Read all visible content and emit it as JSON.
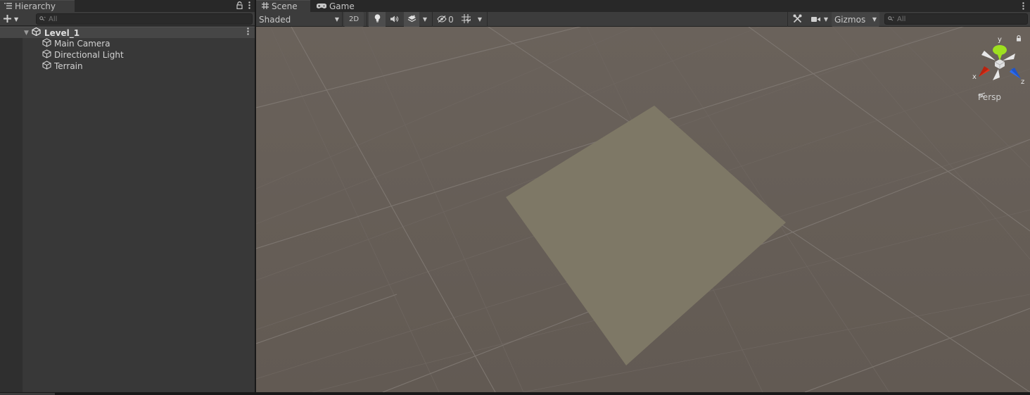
{
  "hierarchy": {
    "tab_label": "Hierarchy",
    "search_placeholder": "All",
    "scene_name": "Level_1",
    "objects": [
      {
        "label": "Main Camera"
      },
      {
        "label": "Directional Light"
      },
      {
        "label": "Terrain"
      }
    ]
  },
  "scene_view": {
    "tabs": [
      {
        "label": "Scene"
      },
      {
        "label": "Game"
      }
    ],
    "toolbar": {
      "draw_mode": "Shaded",
      "mode_2d": "2D",
      "hidden_count": "0",
      "gizmos_label": "Gizmos",
      "search_placeholder": "All"
    },
    "orientation_gizmo": {
      "y_label": "y",
      "x_label": "x",
      "z_label": "z",
      "projection_label": "Persp"
    }
  },
  "colors": {
    "viewport_background": "#675f58",
    "terrain_plane": "#7e7866",
    "panel_background": "#383838",
    "toolbar_background": "#3c3c3c",
    "gizmo_y": "#9ee020",
    "gizmo_x": "#e0321c",
    "gizmo_z": "#2d6cf0"
  }
}
